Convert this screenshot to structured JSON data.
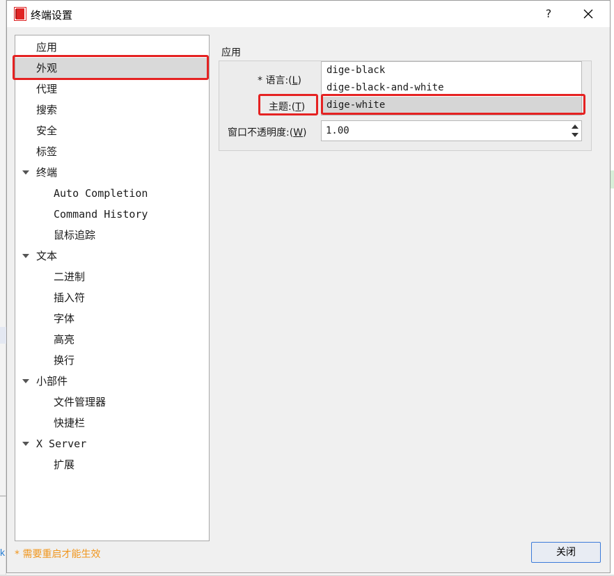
{
  "window": {
    "title": "终端设置",
    "help_glyph": "?"
  },
  "nav": {
    "items": [
      {
        "label": "应用",
        "level": 0
      },
      {
        "label": "外观",
        "level": 0,
        "selected": true
      },
      {
        "label": "代理",
        "level": 0
      },
      {
        "label": "搜索",
        "level": 0
      },
      {
        "label": "安全",
        "level": 0
      },
      {
        "label": "标签",
        "level": 0
      },
      {
        "label": "终端",
        "level": 0,
        "expanded": true
      },
      {
        "label": "Auto Completion",
        "level": 1
      },
      {
        "label": "Command History",
        "level": 1
      },
      {
        "label": "鼠标追踪",
        "level": 1
      },
      {
        "label": "文本",
        "level": 0,
        "expanded": true
      },
      {
        "label": "二进制",
        "level": 1
      },
      {
        "label": "插入符",
        "level": 1
      },
      {
        "label": "字体",
        "level": 1
      },
      {
        "label": "高亮",
        "level": 1
      },
      {
        "label": "换行",
        "level": 1
      },
      {
        "label": "小部件",
        "level": 0,
        "expanded": true
      },
      {
        "label": "文件管理器",
        "level": 1
      },
      {
        "label": "快捷栏",
        "level": 1
      },
      {
        "label": "X Server",
        "level": 0,
        "expanded": true
      },
      {
        "label": "扩展",
        "level": 1
      }
    ]
  },
  "content": {
    "group_title": "应用",
    "language": {
      "required_mark": "*",
      "label": "语言:",
      "mnemonic_open": "(",
      "mnemonic": "L",
      "mnemonic_close": ")"
    },
    "theme": {
      "label": "主题:",
      "mnemonic_open": "(",
      "mnemonic": "T",
      "mnemonic_close": ")",
      "options": [
        "dige-black",
        "dige-black-and-white",
        "dige-white"
      ],
      "selected": "dige-white"
    },
    "opacity": {
      "label": "窗口不透明度:",
      "mnemonic_open": "(",
      "mnemonic": "W",
      "mnemonic_close": ")",
      "value": "1.00"
    }
  },
  "footer": {
    "restart_note": "* 需要重启才能生效",
    "close_label": "关闭"
  },
  "background": {
    "left_edge_text": "k"
  },
  "colors": {
    "highlight_box": "#e52222",
    "note": "#f0961e",
    "button_border": "#3b7ad9",
    "selection": "#d9d9d9"
  },
  "icons": {
    "app": "app-logo-icon",
    "help": "help-icon",
    "close": "close-icon",
    "expand": "chevron-down-icon",
    "spin_up": "arrow-up-icon",
    "spin_down": "arrow-down-icon"
  }
}
